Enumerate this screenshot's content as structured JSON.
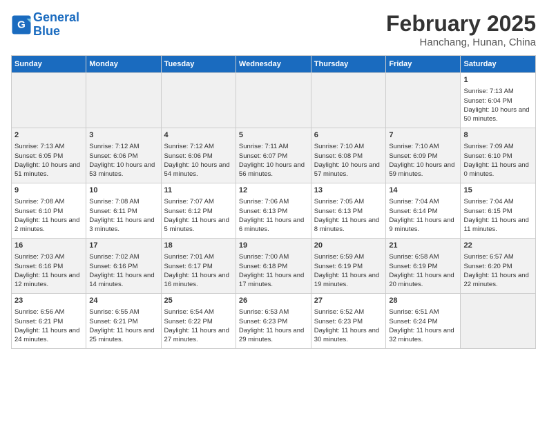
{
  "header": {
    "logo_line1": "General",
    "logo_line2": "Blue",
    "month": "February 2025",
    "location": "Hanchang, Hunan, China"
  },
  "weekdays": [
    "Sunday",
    "Monday",
    "Tuesday",
    "Wednesday",
    "Thursday",
    "Friday",
    "Saturday"
  ],
  "weeks": [
    [
      {
        "day": "",
        "empty": true
      },
      {
        "day": "",
        "empty": true
      },
      {
        "day": "",
        "empty": true
      },
      {
        "day": "",
        "empty": true
      },
      {
        "day": "",
        "empty": true
      },
      {
        "day": "",
        "empty": true
      },
      {
        "day": "1",
        "sunrise": "7:13 AM",
        "sunset": "6:04 PM",
        "daylight": "10 hours and 50 minutes."
      }
    ],
    [
      {
        "day": "2",
        "sunrise": "7:13 AM",
        "sunset": "6:05 PM",
        "daylight": "10 hours and 51 minutes."
      },
      {
        "day": "3",
        "sunrise": "7:12 AM",
        "sunset": "6:06 PM",
        "daylight": "10 hours and 53 minutes."
      },
      {
        "day": "4",
        "sunrise": "7:12 AM",
        "sunset": "6:06 PM",
        "daylight": "10 hours and 54 minutes."
      },
      {
        "day": "5",
        "sunrise": "7:11 AM",
        "sunset": "6:07 PM",
        "daylight": "10 hours and 56 minutes."
      },
      {
        "day": "6",
        "sunrise": "7:10 AM",
        "sunset": "6:08 PM",
        "daylight": "10 hours and 57 minutes."
      },
      {
        "day": "7",
        "sunrise": "7:10 AM",
        "sunset": "6:09 PM",
        "daylight": "10 hours and 59 minutes."
      },
      {
        "day": "8",
        "sunrise": "7:09 AM",
        "sunset": "6:10 PM",
        "daylight": "11 hours and 0 minutes."
      }
    ],
    [
      {
        "day": "9",
        "sunrise": "7:08 AM",
        "sunset": "6:10 PM",
        "daylight": "11 hours and 2 minutes."
      },
      {
        "day": "10",
        "sunrise": "7:08 AM",
        "sunset": "6:11 PM",
        "daylight": "11 hours and 3 minutes."
      },
      {
        "day": "11",
        "sunrise": "7:07 AM",
        "sunset": "6:12 PM",
        "daylight": "11 hours and 5 minutes."
      },
      {
        "day": "12",
        "sunrise": "7:06 AM",
        "sunset": "6:13 PM",
        "daylight": "11 hours and 6 minutes."
      },
      {
        "day": "13",
        "sunrise": "7:05 AM",
        "sunset": "6:13 PM",
        "daylight": "11 hours and 8 minutes."
      },
      {
        "day": "14",
        "sunrise": "7:04 AM",
        "sunset": "6:14 PM",
        "daylight": "11 hours and 9 minutes."
      },
      {
        "day": "15",
        "sunrise": "7:04 AM",
        "sunset": "6:15 PM",
        "daylight": "11 hours and 11 minutes."
      }
    ],
    [
      {
        "day": "16",
        "sunrise": "7:03 AM",
        "sunset": "6:16 PM",
        "daylight": "11 hours and 12 minutes."
      },
      {
        "day": "17",
        "sunrise": "7:02 AM",
        "sunset": "6:16 PM",
        "daylight": "11 hours and 14 minutes."
      },
      {
        "day": "18",
        "sunrise": "7:01 AM",
        "sunset": "6:17 PM",
        "daylight": "11 hours and 16 minutes."
      },
      {
        "day": "19",
        "sunrise": "7:00 AM",
        "sunset": "6:18 PM",
        "daylight": "11 hours and 17 minutes."
      },
      {
        "day": "20",
        "sunrise": "6:59 AM",
        "sunset": "6:19 PM",
        "daylight": "11 hours and 19 minutes."
      },
      {
        "day": "21",
        "sunrise": "6:58 AM",
        "sunset": "6:19 PM",
        "daylight": "11 hours and 20 minutes."
      },
      {
        "day": "22",
        "sunrise": "6:57 AM",
        "sunset": "6:20 PM",
        "daylight": "11 hours and 22 minutes."
      }
    ],
    [
      {
        "day": "23",
        "sunrise": "6:56 AM",
        "sunset": "6:21 PM",
        "daylight": "11 hours and 24 minutes."
      },
      {
        "day": "24",
        "sunrise": "6:55 AM",
        "sunset": "6:21 PM",
        "daylight": "11 hours and 25 minutes."
      },
      {
        "day": "25",
        "sunrise": "6:54 AM",
        "sunset": "6:22 PM",
        "daylight": "11 hours and 27 minutes."
      },
      {
        "day": "26",
        "sunrise": "6:53 AM",
        "sunset": "6:23 PM",
        "daylight": "11 hours and 29 minutes."
      },
      {
        "day": "27",
        "sunrise": "6:52 AM",
        "sunset": "6:23 PM",
        "daylight": "11 hours and 30 minutes."
      },
      {
        "day": "28",
        "sunrise": "6:51 AM",
        "sunset": "6:24 PM",
        "daylight": "11 hours and 32 minutes."
      },
      {
        "day": "",
        "empty": true
      }
    ]
  ]
}
